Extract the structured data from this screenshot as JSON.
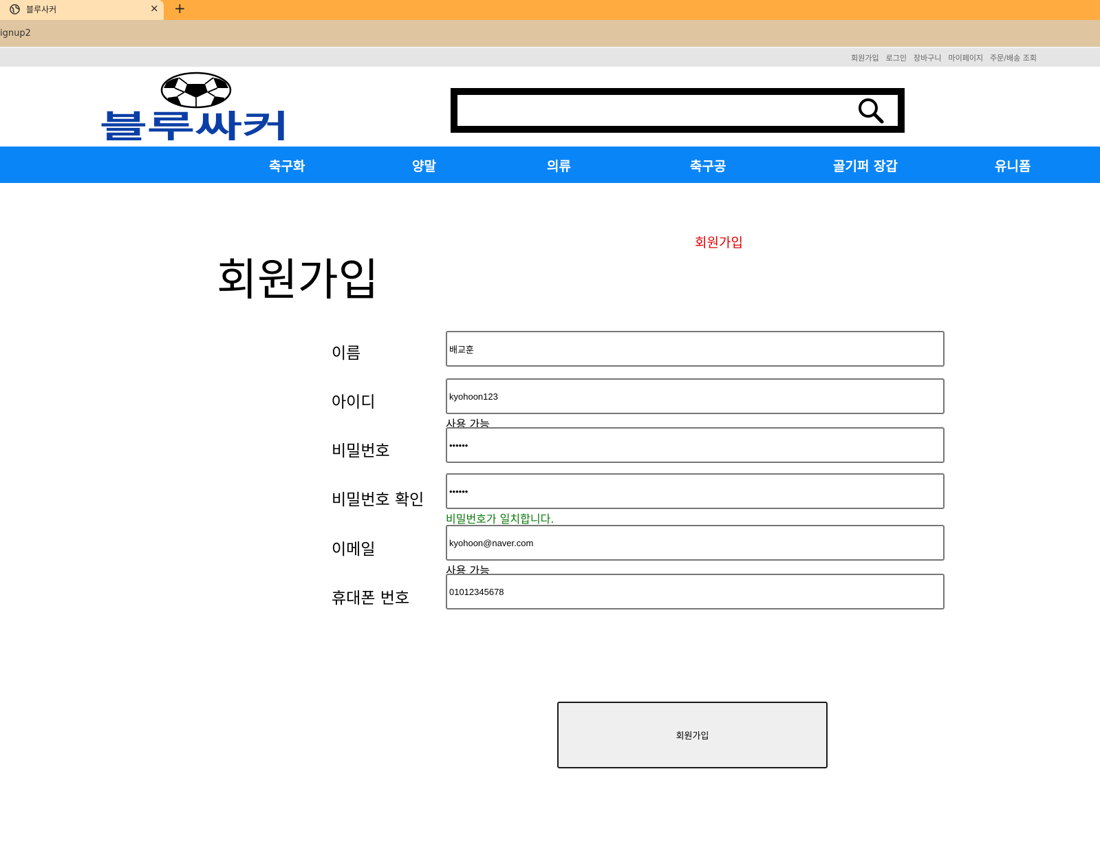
{
  "browser": {
    "tab_title": "블루사커",
    "tab_close": "×",
    "new_tab": "+",
    "address": "ignup2"
  },
  "util_links": [
    "회원가입",
    "로그인",
    "장바구니",
    "마이페이지",
    "주문/배송 조회"
  ],
  "logo": {
    "text": "블루싸커",
    "brand_color": "#0b3fa6"
  },
  "search": {
    "value": "",
    "placeholder": ""
  },
  "nav": [
    "축구화",
    "양말",
    "의류",
    "축구공",
    "골기퍼 장갑",
    "유니폼"
  ],
  "colors": {
    "nav_bg": "#0a85f7",
    "side_title": "#e00000",
    "ok_text": "#0a7a0a"
  },
  "side_title": "회원가입",
  "page_title": "회원가입",
  "form": {
    "name_label": "이름",
    "name_value": "배교훈",
    "id_label": "아이디",
    "id_value": "kyohoon123",
    "id_hint": "사용 가능",
    "pw_label": "비밀번호",
    "pw_value": "••••••",
    "pw_confirm_label": "비밀번호 확인",
    "pw_confirm_value": "••••••",
    "pw_match_hint": "비밀번호가 일치합니다.",
    "email_label": "이메일",
    "email_value": "kyohoon@naver.com",
    "email_hint": "사용 가능",
    "phone_label": "휴대폰 번호",
    "phone_value": "01012345678",
    "submit_label": "회원가입"
  }
}
